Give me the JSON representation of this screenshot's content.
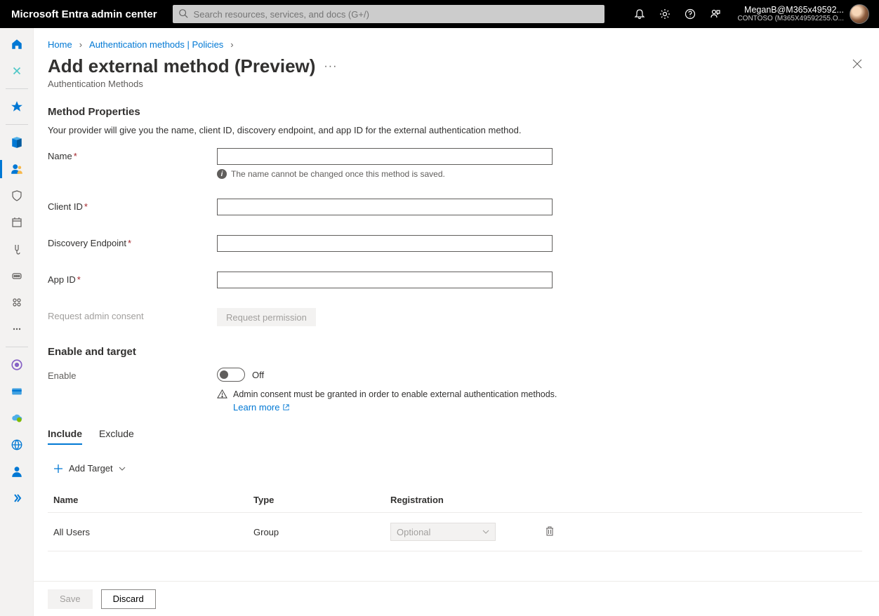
{
  "topbar": {
    "brand": "Microsoft Entra admin center",
    "search_placeholder": "Search resources, services, and docs (G+/)",
    "account": {
      "user": "MeganB@M365x49592...",
      "tenant": "CONTOSO (M365X49592255.O..."
    }
  },
  "rail": {
    "items": [
      {
        "name": "home",
        "color": "#0078d4"
      },
      {
        "name": "diagnose",
        "color": "#50e6ff"
      },
      {
        "name": "favorites",
        "color": "#0078d4"
      },
      {
        "name": "identity",
        "color": "#0078d4"
      },
      {
        "name": "users",
        "color": "#0078d4",
        "active": true
      },
      {
        "name": "protection",
        "color": "#605e5c"
      },
      {
        "name": "governance",
        "color": "#605e5c"
      },
      {
        "name": "verification",
        "color": "#605e5c"
      },
      {
        "name": "permissions",
        "color": "#605e5c"
      },
      {
        "name": "groups",
        "color": "#605e5c"
      },
      {
        "name": "more",
        "color": "#605e5c"
      },
      {
        "name": "hybrid",
        "color": "#8661c5"
      },
      {
        "name": "billing",
        "color": "#0078d4"
      },
      {
        "name": "cloud",
        "color": "#0078d4"
      },
      {
        "name": "global",
        "color": "#0078d4"
      },
      {
        "name": "person",
        "color": "#0078d4"
      },
      {
        "name": "expand",
        "color": "#0078d4"
      }
    ]
  },
  "breadcrumb": {
    "home": "Home",
    "auth": "Authentication methods | Policies"
  },
  "page": {
    "title": "Add external method (Preview)",
    "subtitle": "Authentication Methods"
  },
  "method_props": {
    "heading": "Method Properties",
    "desc": "Your provider will give you the name, client ID, discovery endpoint, and app ID for the external authentication method.",
    "fields": {
      "name_label": "Name",
      "name_hint": "The name cannot be changed once this method is saved.",
      "client_id_label": "Client ID",
      "discovery_label": "Discovery Endpoint",
      "app_id_label": "App ID",
      "consent_label": "Request admin consent",
      "permission_btn": "Request permission"
    }
  },
  "enable": {
    "heading": "Enable and target",
    "enable_label": "Enable",
    "toggle_state": "Off",
    "warning": "Admin consent must be granted in order to enable external authentication methods.",
    "learn_more": "Learn more"
  },
  "tabs": {
    "include": "Include",
    "exclude": "Exclude"
  },
  "target": {
    "add_label": "Add Target",
    "columns": {
      "name": "Name",
      "type": "Type",
      "registration": "Registration"
    },
    "rows": [
      {
        "name": "All Users",
        "type": "Group",
        "registration": "Optional"
      }
    ]
  },
  "footer": {
    "save": "Save",
    "discard": "Discard"
  }
}
